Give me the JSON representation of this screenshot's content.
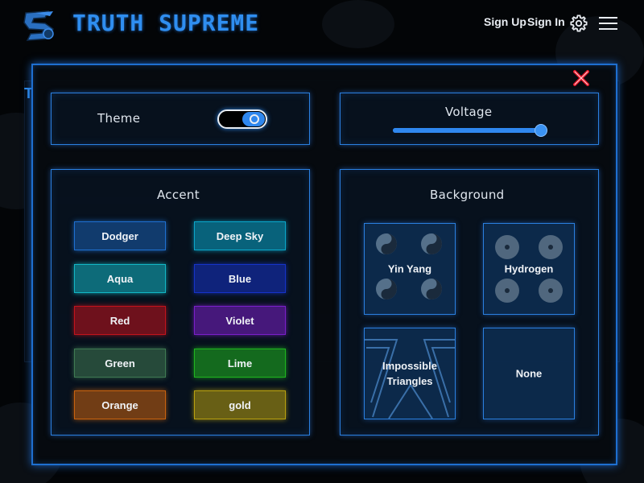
{
  "header": {
    "brand": "TRUTH SUPREME",
    "logo_icon": "logo-icon",
    "sign_up": "Sign Up",
    "sign_in": "Sign In",
    "settings_icon": "gear-icon",
    "menu_icon": "hamburger-icon"
  },
  "background_page": {
    "title_fragment": "T"
  },
  "settings": {
    "close_icon": "close-icon",
    "theme": {
      "label": "Theme",
      "value": "on"
    },
    "voltage": {
      "label": "Voltage",
      "level": 1.0
    },
    "accent": {
      "title": "Accent",
      "options": [
        {
          "label": "Dodger",
          "color": "#1e6fd0",
          "selected": true
        },
        {
          "label": "Deep Sky",
          "color": "#0aa6c9"
        },
        {
          "label": "Aqua",
          "color": "#12b6c4"
        },
        {
          "label": "Blue",
          "color": "#1533c8"
        },
        {
          "label": "Red",
          "color": "#c3131c"
        },
        {
          "label": "Violet",
          "color": "#7a1fc9"
        },
        {
          "label": "Green",
          "color": "#3f7a52"
        },
        {
          "label": "Lime",
          "color": "#1fb51f"
        },
        {
          "label": "Orange",
          "color": "#c8620e"
        },
        {
          "label": "gold",
          "color": "#b8a00f"
        }
      ]
    },
    "background": {
      "title": "Background",
      "options": [
        {
          "label": "Yin Yang",
          "icon": "yin-yang-icon"
        },
        {
          "label": "Hydrogen",
          "icon": "hydrogen-icon"
        },
        {
          "label": "Impossible Triangles",
          "icon": "impossible-triangle-icon"
        },
        {
          "label": "None"
        }
      ]
    }
  },
  "colors": {
    "primary": "#2f8ef0",
    "panel_border": "#2a7fdf",
    "close": "#e8162a"
  }
}
